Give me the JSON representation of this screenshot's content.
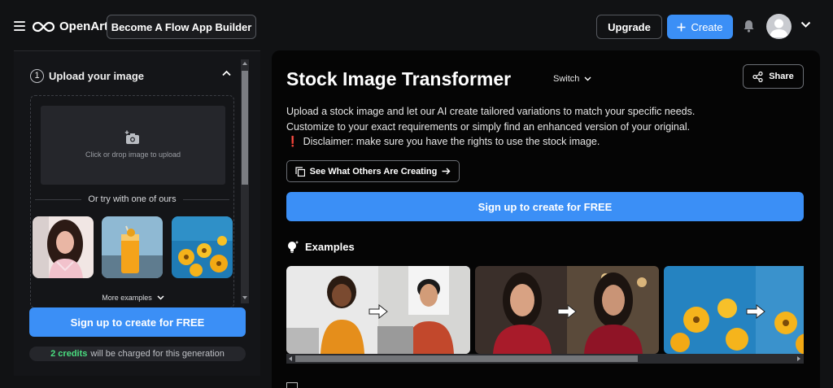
{
  "header": {
    "logo_text": "OpenArt",
    "flow_button": "Become A Flow App Builder",
    "upgrade_button": "Upgrade",
    "create_button": "Create",
    "icons": [
      "menu-icon",
      "openart-logo-icon",
      "plus-icon",
      "bell-icon",
      "avatar",
      "chevron-down-icon"
    ]
  },
  "sidebar": {
    "step_number": "1",
    "step_title": "Upload your image",
    "dropzone_text": "Click or drop image to upload",
    "or_text": "Or try with one of ours",
    "samples": [
      "portrait-sample",
      "drink-sample",
      "flowers-sample"
    ],
    "more_examples": "More examples",
    "cta": "Sign up to create for FREE",
    "credits_count": "2 credits",
    "credits_rest": "will be charged for this generation"
  },
  "main": {
    "title": "Stock Image Transformer",
    "switch_label": "Switch",
    "share_label": "Share",
    "description_line1": "Upload a stock image and let our AI create tailored variations to match your specific needs.",
    "description_line2": "Customize to your exact requirements or simply find an enhanced version of your original.",
    "disclaimer": "Disclaimer: make sure you have the rights to use the stock image.",
    "disclaimer_mark": "❗",
    "others_button": "See What Others Are Creating",
    "cta": "Sign up to create for FREE",
    "examples_heading": "Examples",
    "examples": [
      "office-workers-example",
      "woman-portrait-example",
      "yellow-flowers-example"
    ]
  },
  "colors": {
    "accent": "#3b8ff6",
    "background": "#111214",
    "panel": "#050505",
    "credits_green": "#4ade80",
    "disclaimer_red": "#ef4444"
  }
}
